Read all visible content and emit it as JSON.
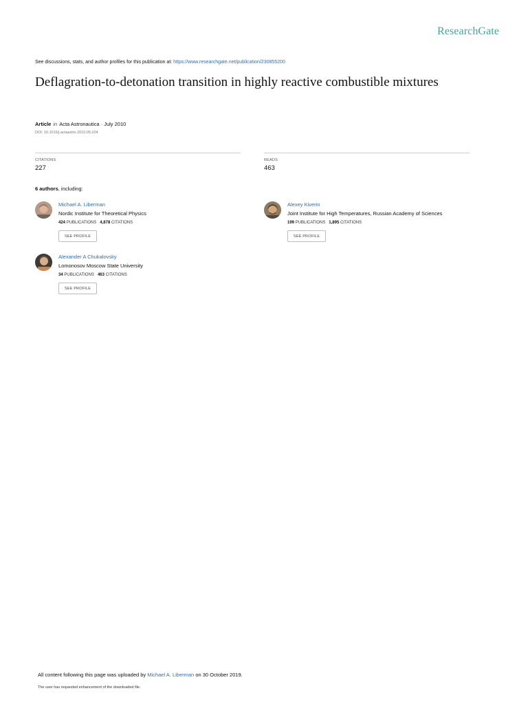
{
  "brand": {
    "logo_text": "ResearchGate",
    "accent": "#3aa7a0",
    "link_color": "#2f6db5"
  },
  "header": {
    "discuss_prefix": "See discussions, stats, and author profiles for this publication at: ",
    "url": "https://www.researchgate.net/publication/230855200"
  },
  "publication": {
    "title": "Deflagration-to-detonation transition in highly reactive combustible mixtures",
    "type": "Article",
    "in_word": "in",
    "journal": "Acta Astronautica · July 2010",
    "doi": "DOI: 10.1016/j.actaastro.2010.05.024"
  },
  "stats": {
    "citations_label": "CITATIONS",
    "citations_value": "227",
    "reads_label": "READS",
    "reads_value": "463"
  },
  "authors_header": {
    "count": "6 authors",
    "suffix": ", including:"
  },
  "authors": [
    {
      "name": "Michael A. Liberman",
      "institution": "Nordic Institute for Theoretical Physics",
      "pubs": "424",
      "pubs_label": "PUBLICATIONS",
      "cites": "4,878",
      "cites_label": "CITATIONS",
      "button": "SEE PROFILE"
    },
    {
      "name": "Alexey Kiverin",
      "institution": "Joint Institute for High Temperatures, Russian Academy of Sciences",
      "pubs": "199",
      "pubs_label": "PUBLICATIONS",
      "cites": "1,895",
      "cites_label": "CITATIONS",
      "button": "SEE PROFILE"
    },
    {
      "name": "Alexander A Chukalovsky",
      "institution": "Lomonosov Moscow State University",
      "pubs": "34",
      "pubs_label": "PUBLICATIONS",
      "cites": "463",
      "cites_label": "CITATIONS",
      "button": "SEE PROFILE"
    }
  ],
  "footer": {
    "uploaded_prefix": "All content following this page was uploaded by ",
    "uploader": "Michael A. Liberman",
    "uploaded_suffix": " on 30 October 2019.",
    "note": "The user has requested enhancement of the downloaded file."
  }
}
